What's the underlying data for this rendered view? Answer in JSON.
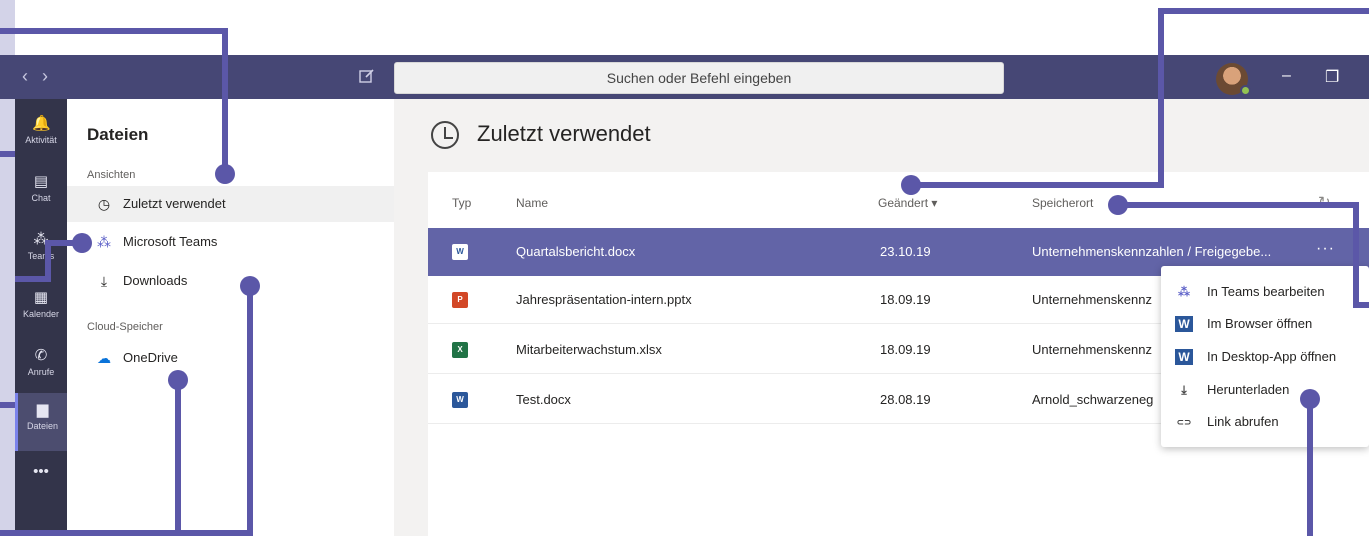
{
  "topbar": {
    "back_glyph": "‹",
    "forward_glyph": "›",
    "compose_icon": "compose-icon",
    "search_placeholder": "Suchen oder Befehl eingeben",
    "minimize_glyph": "–",
    "restore_glyph": "❐",
    "presence_color": "#92c353"
  },
  "rail": {
    "items": [
      {
        "label": "Aktivität",
        "icon": "bell-icon",
        "glyph": "🔔"
      },
      {
        "label": "Chat",
        "icon": "chat-icon",
        "glyph": "▤"
      },
      {
        "label": "Teams",
        "icon": "teams-icon",
        "glyph": "⁂"
      },
      {
        "label": "Kalender",
        "icon": "calendar-icon",
        "glyph": "▦"
      },
      {
        "label": "Anrufe",
        "icon": "phone-icon",
        "glyph": "✆"
      },
      {
        "label": "Dateien",
        "icon": "files-icon",
        "glyph": "▆",
        "active": true
      },
      {
        "label": "",
        "icon": "more-icon",
        "glyph": "•••"
      }
    ]
  },
  "panel": {
    "title": "Dateien",
    "views_label": "Ansichten",
    "views": [
      {
        "label": "Zuletzt verwendet",
        "icon": "clock-icon",
        "glyph": "◷",
        "selected": true
      },
      {
        "label": "Microsoft Teams",
        "icon": "teams-icon",
        "glyph": "⁂"
      },
      {
        "label": "Downloads",
        "icon": "download-icon",
        "glyph": "⤓"
      }
    ],
    "cloud_label": "Cloud-Speicher",
    "cloud": [
      {
        "label": "OneDrive",
        "icon": "cloud-icon",
        "glyph": "☁"
      }
    ]
  },
  "main": {
    "title": "Zuletzt verwendet",
    "columns": {
      "type": "Typ",
      "name": "Name",
      "modified": "Geändert ▾",
      "location": "Speicherort"
    },
    "rows": [
      {
        "type_icon": "word-icon",
        "type_letter": "W",
        "type_color": "#2b579a",
        "name": "Quartalsbericht.docx",
        "modified": "23.10.19",
        "location": "Unternehmenskennzahlen / Freigegebe...",
        "more": "···",
        "selected": true
      },
      {
        "type_icon": "powerpoint-icon",
        "type_letter": "P",
        "type_color": "#d24726",
        "name": "Jahrespräsentation-intern.pptx",
        "modified": "18.09.19",
        "location": "Unternehmenskennz"
      },
      {
        "type_icon": "excel-icon",
        "type_letter": "X",
        "type_color": "#217346",
        "name": "Mitarbeiterwachstum.xlsx",
        "modified": "18.09.19",
        "location": "Unternehmenskennz"
      },
      {
        "type_icon": "word-icon",
        "type_letter": "W",
        "type_color": "#2b579a",
        "name": "Test.docx",
        "modified": "28.08.19",
        "location": "Arnold_schwarzeneg"
      }
    ]
  },
  "context_menu": {
    "items": [
      {
        "label": "In Teams bearbeiten",
        "icon": "teams-icon",
        "glyph": "⁂",
        "color": "#5b5fc7"
      },
      {
        "label": "Im Browser öffnen",
        "icon": "word-icon",
        "glyph": "W",
        "color": "#2b579a"
      },
      {
        "label": "In Desktop-App öffnen",
        "icon": "word-icon",
        "glyph": "W",
        "color": "#2b579a"
      },
      {
        "label": "Herunterladen",
        "icon": "download-icon",
        "glyph": "⤓",
        "color": "#444444"
      },
      {
        "label": "Link abrufen",
        "icon": "link-icon",
        "glyph": "⊂⊃",
        "color": "#444444"
      }
    ]
  },
  "accent_color": "#5b57a8"
}
